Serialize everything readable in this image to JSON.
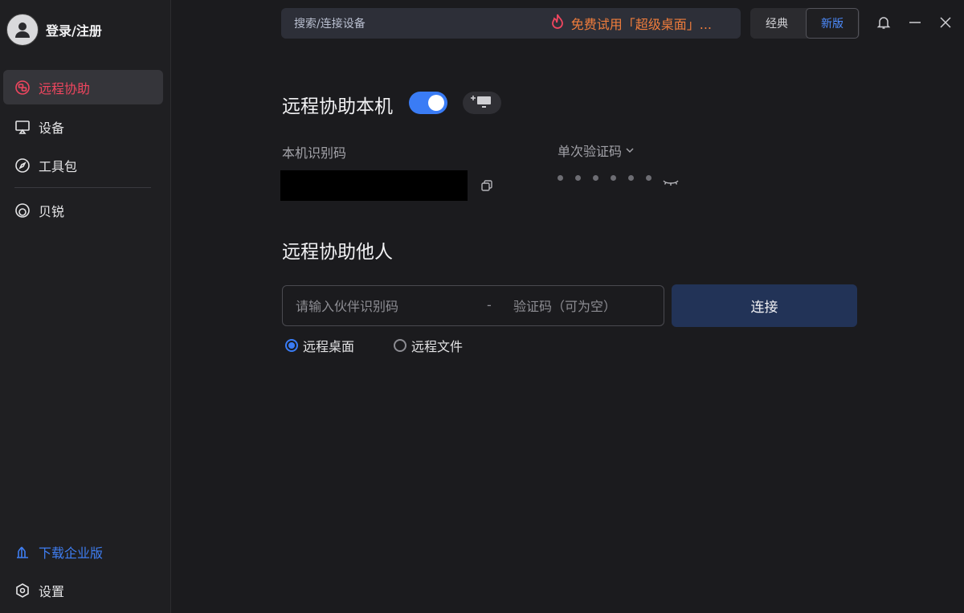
{
  "sidebar": {
    "user_label": "登录/注册",
    "items": [
      {
        "label": "远程协助",
        "icon": "remote-assist-icon"
      },
      {
        "label": "设备",
        "icon": "monitor-icon"
      },
      {
        "label": "工具包",
        "icon": "compass-icon"
      },
      {
        "label": "贝锐",
        "icon": "oray-logo-icon"
      }
    ],
    "download_label": "下载企业版",
    "settings_label": "设置"
  },
  "topbar": {
    "search_placeholder": "搜索/连接设备",
    "promo_text": "免费试用「超级桌面」...",
    "mode_classic": "经典",
    "mode_new": "新版"
  },
  "assist_self": {
    "title": "远程协助本机",
    "toggle_on": true,
    "id_label": "本机识别码",
    "code_type_label": "单次验证码",
    "code_mask_count": 6
  },
  "assist_others": {
    "title": "远程协助他人",
    "partner_placeholder": "请输入伙伴识别码",
    "separator": "-",
    "verify_placeholder": "验证码（可为空）",
    "connect_label": "连接",
    "modes": [
      {
        "label": "远程桌面",
        "selected": true
      },
      {
        "label": "远程文件",
        "selected": false
      }
    ]
  },
  "colors": {
    "accent_blue": "#3a7cf5",
    "active_red": "#f0465f",
    "promo_orange": "#f07d3c",
    "connect_bg": "#223357"
  }
}
